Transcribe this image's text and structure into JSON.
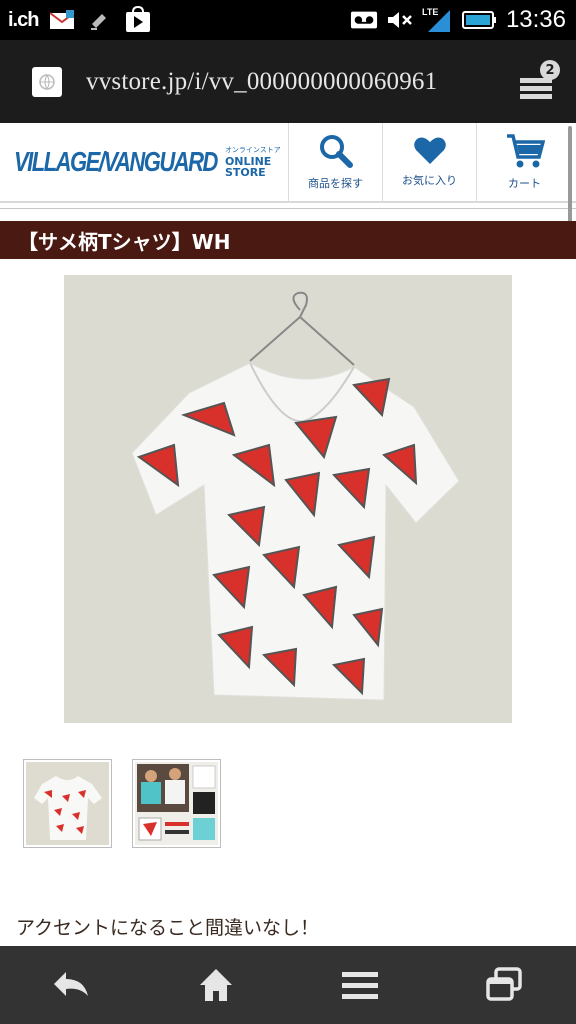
{
  "status_bar": {
    "carrier_label": "i.ch",
    "network": "LTE",
    "time": "13:36",
    "icons": [
      "mail-icon",
      "download-icon",
      "play-store-icon",
      "voicemail-icon",
      "mute-icon",
      "signal-icon",
      "battery-icon"
    ]
  },
  "browser": {
    "url": "vvstore.jp/i/vv_000000000060961",
    "tab_count": "2"
  },
  "site_header": {
    "logo_main": "VILLAGE/VANGUARD",
    "logo_sub_small": "オンラインストア",
    "logo_sub_big": "ONLINE STORE",
    "nav": [
      {
        "label": "商品を探す",
        "icon": "search-icon"
      },
      {
        "label": "お気に入り",
        "icon": "heart-icon"
      },
      {
        "label": "カート",
        "icon": "cart-icon"
      }
    ],
    "accent_color": "#1b67a8"
  },
  "product": {
    "title": "【サメ柄Tシャツ】WH",
    "title_bar_color": "#4a1a12",
    "description": "アクセントになること間違いなし！",
    "thumbnails": [
      {
        "name": "thumbnail-shark-tshirt-white"
      },
      {
        "name": "thumbnail-shark-tshirt-variants"
      }
    ]
  },
  "bottom_nav": {
    "buttons": [
      "back-icon",
      "home-icon",
      "menu-icon",
      "windows-icon"
    ]
  }
}
